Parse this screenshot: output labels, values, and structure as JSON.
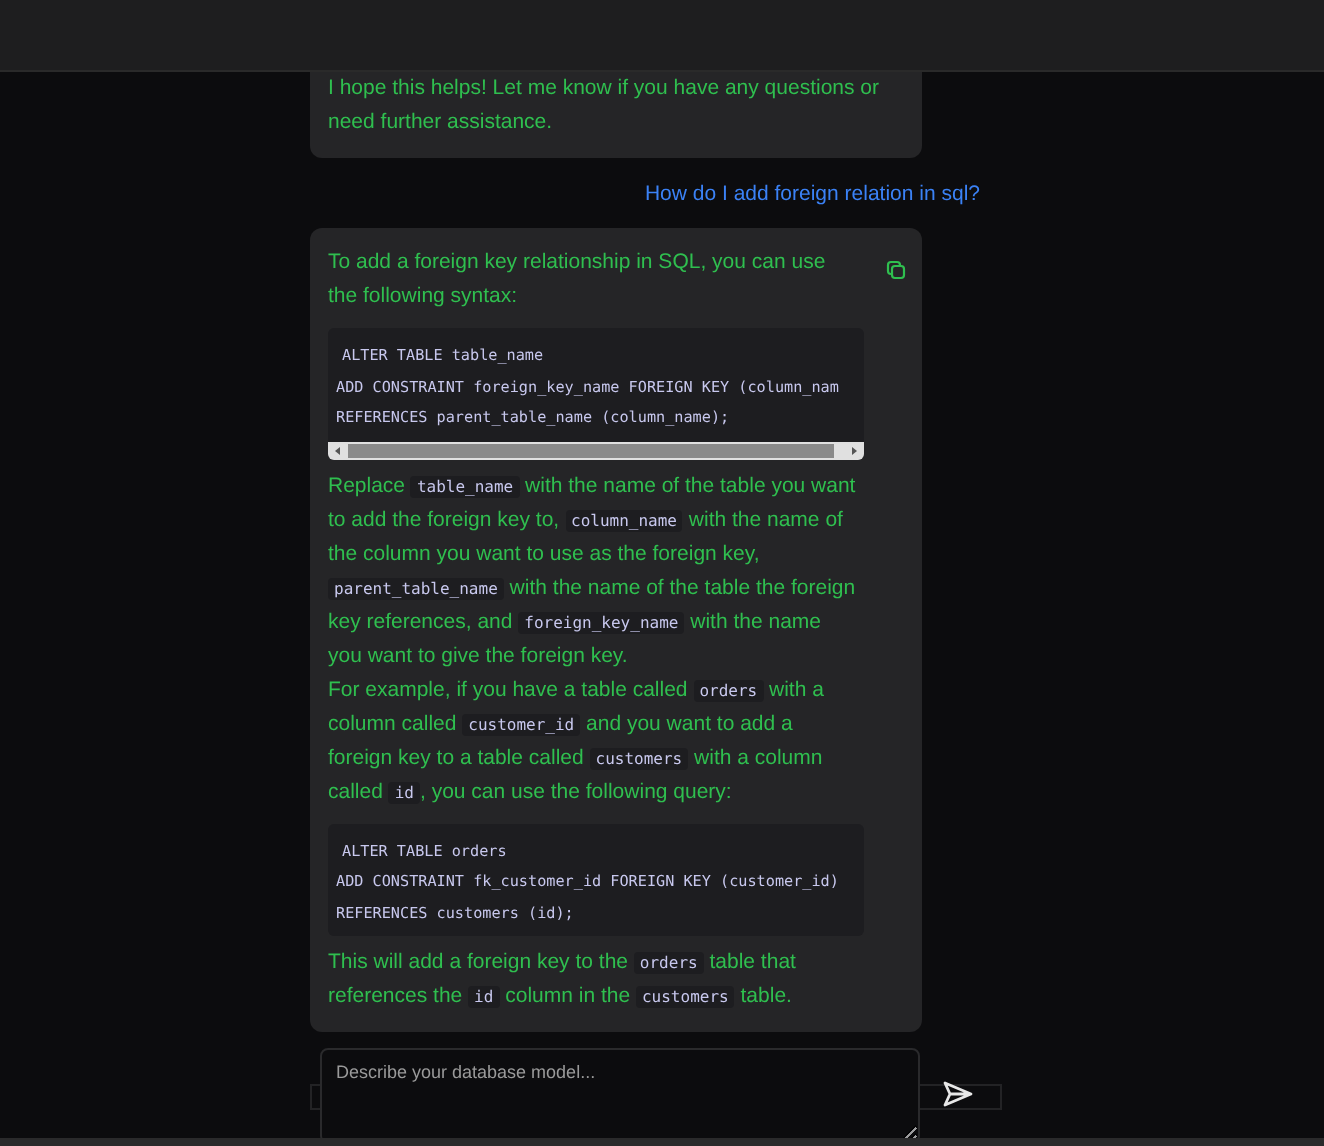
{
  "messages": [
    {
      "kind": "assistant",
      "copy_button": false,
      "blocks": [
        {
          "kind": "para",
          "parts": [
            {
              "kind": "text",
              "text": "I hope this helps! Let me know if you have any questions or need further assistance."
            }
          ]
        }
      ]
    },
    {
      "kind": "user",
      "text": "How do I add foreign relation in sql?"
    },
    {
      "kind": "assistant",
      "copy_button": true,
      "blocks": [
        {
          "kind": "para",
          "parts": [
            {
              "kind": "text",
              "text": "To add a foreign key relationship in SQL, you can use the following syntax:"
            }
          ]
        },
        {
          "kind": "code",
          "scrollbar": true,
          "lines": [
            "ALTER TABLE table_name",
            "ADD CONSTRAINT foreign_key_name FOREIGN KEY (column_nam",
            "REFERENCES parent_table_name (column_name);"
          ]
        },
        {
          "kind": "para",
          "parts": [
            {
              "kind": "text",
              "text": "Replace "
            },
            {
              "kind": "code",
              "text": "table_name"
            },
            {
              "kind": "text",
              "text": " with the name of the table you want to add the foreign key to, "
            },
            {
              "kind": "code",
              "text": "column_name"
            },
            {
              "kind": "text",
              "text": " with the name of the column you want to use as the foreign key, "
            },
            {
              "kind": "code",
              "text": "parent_table_name"
            },
            {
              "kind": "text",
              "text": " with the name of the table the foreign key references, and "
            },
            {
              "kind": "code",
              "text": "foreign_key_name"
            },
            {
              "kind": "text",
              "text": " with the name you want to give the foreign key."
            }
          ]
        },
        {
          "kind": "para",
          "parts": [
            {
              "kind": "text",
              "text": "For example, if you have a table called "
            },
            {
              "kind": "code",
              "text": "orders"
            },
            {
              "kind": "text",
              "text": " with a column called "
            },
            {
              "kind": "code",
              "text": "customer_id"
            },
            {
              "kind": "text",
              "text": " and you want to add a foreign key to a table called "
            },
            {
              "kind": "code",
              "text": "customers"
            },
            {
              "kind": "text",
              "text": " with a column called "
            },
            {
              "kind": "code",
              "text": "id"
            },
            {
              "kind": "text",
              "text": ", you can use the following query:"
            }
          ]
        },
        {
          "kind": "code",
          "scrollbar": false,
          "lines": [
            "ALTER TABLE orders",
            "ADD CONSTRAINT fk_customer_id FOREIGN KEY (customer_id)",
            "REFERENCES customers (id);"
          ]
        },
        {
          "kind": "para",
          "parts": [
            {
              "kind": "text",
              "text": "This will add a foreign key to the "
            },
            {
              "kind": "code",
              "text": "orders"
            },
            {
              "kind": "text",
              "text": " table that references the "
            },
            {
              "kind": "code",
              "text": "id"
            },
            {
              "kind": "text",
              "text": " column in the "
            },
            {
              "kind": "code",
              "text": "customers"
            },
            {
              "kind": "text",
              "text": " table."
            }
          ]
        }
      ]
    }
  ],
  "composer": {
    "placeholder": "Describe your database model..."
  }
}
